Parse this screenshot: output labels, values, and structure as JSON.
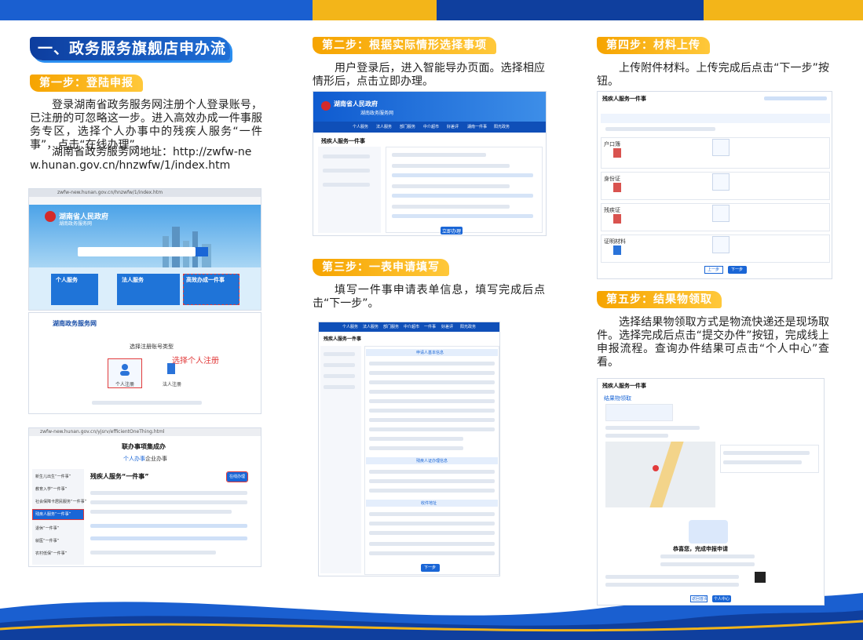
{
  "section": {
    "title": "一、政务服务旗舰店申办流程"
  },
  "steps": [
    {
      "badge": "第一步：登陆申报",
      "text": "登录湖南省政务服务网注册个人登录账号，已注册的可忽略这一步。进入高效办成一件事服务专区，选择个人办事中的残疾人服务“一件事”，点击“在线办理”。",
      "address_label": "湖南省政务服务网地址：http://zwfw-new.hunan.gov.cn/hnzwfw/1/index.htm"
    },
    {
      "badge": "第二步：根据实际情形选择事项",
      "text": "用户登录后，进入智能导办页面。选择相应情形后，点击立即办理。"
    },
    {
      "badge": "第三步：一表申请填写",
      "text": "填写一件事申请表单信息，填写完成后点击“下一步”。"
    },
    {
      "badge": "第四步：材料上传",
      "text": "上传附件材料。上传完成后点击“下一步”按钮。"
    },
    {
      "badge": "第五步：结果物领取",
      "text": "选择结果物领取方式是物流快递还是现场取件。选择完成后点击“提交办件”按钮，完成线上申报流程。查询办件结果可点击“个人中心”查看。"
    }
  ],
  "screens": {
    "s1_url": "zwfw-new.hunan.gov.cn/hnzwfw/1/index.htm",
    "s1_site": "湖南省人民政府",
    "s1_sub": "湖南政务服务网",
    "s1_panel_a": "个人服务",
    "s1_panel_b": "法人服务",
    "s1_panel_c": "高效办成一件事",
    "s2_site": "湖南政务服务网",
    "s2_choose": "选择注册账号类型",
    "s2_person": "个人注册",
    "s2_corp": "法人注册",
    "s2_note": "选择个人注册",
    "s3_url": "zwfw-new.hunan.gov.cn/yjsrv/efficientOneThing.html",
    "s3_title": "联办事项集成办",
    "s3_tab_a": "个人办事",
    "s3_tab_b": "企业办事",
    "s3_head": "残疾人服务“一件事”",
    "s3_btn_a": "在线办理",
    "s3_side": [
      "新生儿出生“一件事”",
      "教育入学“一件事”",
      "社会保障卡居民服务“一件事”",
      "残疾人服务“一件事”",
      "退休“一件事”",
      "就医“一件事”",
      "农村低保“一件事”"
    ],
    "s4_site": "湖南省人民政府",
    "s4_sub": "湖南政务服务网",
    "s4_title": "残疾人服务一件事",
    "s4_nav": [
      "个人服务",
      "法人服务",
      "部门服务",
      "中介超市",
      "好差评",
      "湖南一件事",
      "阳光政务"
    ],
    "s4_btn": "立即办理",
    "s5_title": "残疾人服务一件事",
    "s5_nav": [
      "个人服务",
      "法人服务",
      "部门服务",
      "中介超市",
      "一件事",
      "好差评",
      "阳光政务"
    ],
    "s5_sec_a": "申请人基本信息",
    "s5_sec_b": "残疾人证办理信息",
    "s5_sec_c": "收件地址",
    "s5_btn": "下一步",
    "s6_title": "残疾人服务一件事",
    "s6_files": [
      "户口簿",
      "身份证",
      "残疾证",
      "证明材料"
    ],
    "s6_btn_prev": "上一步",
    "s6_btn_next": "下一步",
    "s7_title": "残疾人服务一件事",
    "s7_head": "结果物领取",
    "s7_done": "恭喜您，完成申报申请",
    "s7_btn_a": "返回首页",
    "s7_btn_b": "个人中心"
  },
  "colors": {
    "primary": "#0d3d9e",
    "accent": "#f6a400",
    "sky": "#1f6fd6"
  }
}
